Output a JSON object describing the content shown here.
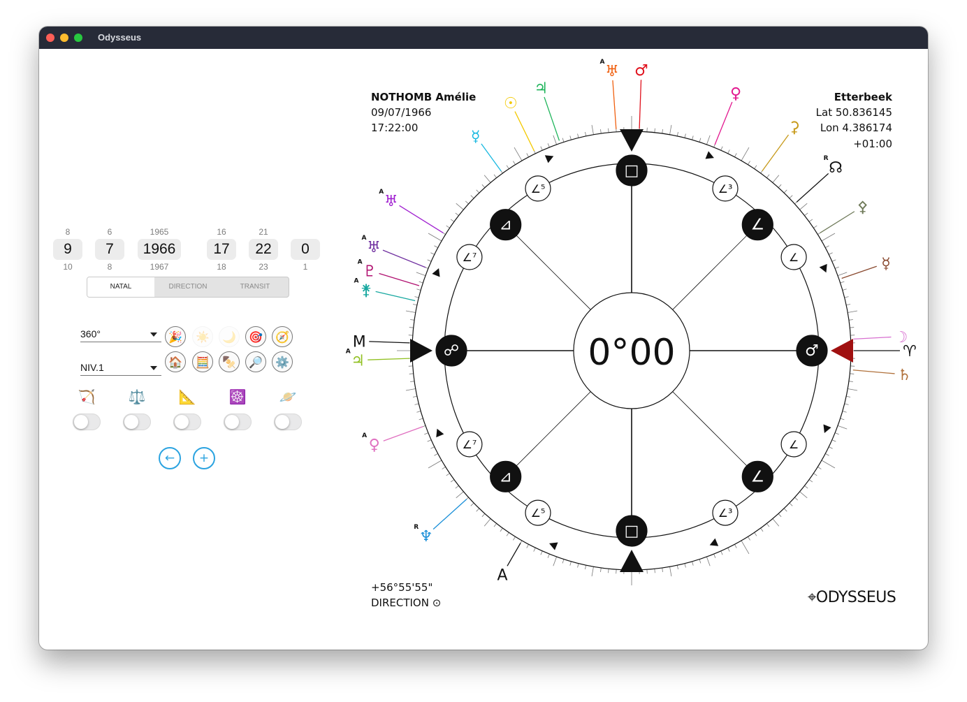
{
  "window": {
    "title": "Odysseus"
  },
  "pickers": [
    {
      "prev": "8",
      "value": "9",
      "next": "10"
    },
    {
      "prev": "6",
      "value": "7",
      "next": "8"
    },
    {
      "prev": "1965",
      "value": "1966",
      "next": "1967"
    },
    {
      "prev": "16",
      "value": "17",
      "next": "18"
    },
    {
      "prev": "21",
      "value": "22",
      "next": "23"
    },
    {
      "prev": "",
      "value": "0",
      "next": "1"
    }
  ],
  "modes": {
    "natal": "NATAL",
    "direction": "DIRECTION",
    "transit": "TRANSIT",
    "selected": "NATAL"
  },
  "selects": {
    "range": "360°",
    "level": "NIV.1"
  },
  "icons_row1": [
    "🎉",
    "☀️",
    "🌙",
    "🎯",
    "🧭"
  ],
  "icons_row2": [
    "🏠",
    "🧮",
    "🍢",
    "🔎",
    "⚙️"
  ],
  "tools": [
    "🏹",
    "⚖️",
    "📐",
    "☸️",
    "🪐"
  ],
  "toggles": [
    false,
    false,
    false,
    false,
    false
  ],
  "actions": {
    "back": "←",
    "add": "+"
  },
  "person": {
    "name": "NOTHOMB Amélie",
    "date": "09/07/1966",
    "time": "17:22:00"
  },
  "place": {
    "city": "Etterbeek",
    "lat": "Lat 50.836145",
    "lon": "Lon 4.386174",
    "tz": "+01:00"
  },
  "footer": {
    "angle": "+56°55'55\"",
    "mode": "DIRECTION ⊙"
  },
  "center": {
    "value": "0°00"
  },
  "brand": {
    "logo": "ODYSSEUS"
  },
  "aspects": {
    "cardinal": [
      "□",
      "♂",
      "□",
      "☍"
    ],
    "diagonal": [
      "∠",
      "∠",
      "⊿",
      "⊿"
    ],
    "small": [
      "∠³",
      "∠",
      "∠",
      "∠³",
      "∠⁵",
      "∠⁷",
      "∠⁷",
      "∠⁵"
    ]
  },
  "planets": [
    {
      "symbol": "☉",
      "color": "#f3c900",
      "label": ""
    },
    {
      "symbol": "♃",
      "color": "#1eb45a",
      "label": ""
    },
    {
      "symbol": "♅",
      "color": "#f06010",
      "label": "A"
    },
    {
      "symbol": "♂",
      "color": "#e0101c",
      "label": ""
    },
    {
      "symbol": "♀",
      "color": "#e2188f",
      "label": ""
    },
    {
      "symbol": "⚳",
      "color": "#c79a1a",
      "label": ""
    },
    {
      "symbol": "☊",
      "color": "#111111",
      "label": "R"
    },
    {
      "symbol": "⚴",
      "color": "#6f7a59",
      "label": ""
    },
    {
      "symbol": "☿",
      "color": "#8a4a30",
      "label": ""
    },
    {
      "symbol": "☽",
      "color": "#d870d0",
      "label": ""
    },
    {
      "symbol": "♈",
      "color": "#111111",
      "label": ""
    },
    {
      "symbol": "♄",
      "color": "#b0703a",
      "label": ""
    },
    {
      "symbol": "♆",
      "color": "#1a8fd8",
      "label": "R"
    },
    {
      "symbol": "A",
      "color": "#111111",
      "label": ""
    },
    {
      "symbol": "♅",
      "color": "#7030a0",
      "label": "A"
    },
    {
      "symbol": "♀",
      "color": "#e070c0",
      "label": "A"
    },
    {
      "symbol": "♃",
      "color": "#90c020",
      "label": "A"
    },
    {
      "symbol": "M",
      "color": "#111111",
      "label": ""
    },
    {
      "symbol": "⚵",
      "color": "#18a8a0",
      "label": "A"
    },
    {
      "symbol": "♇",
      "color": "#b01070",
      "label": "A"
    },
    {
      "symbol": "♅",
      "color": "#a020d0",
      "label": "A"
    },
    {
      "symbol": "☿",
      "color": "#18b8e0",
      "label": ""
    }
  ]
}
